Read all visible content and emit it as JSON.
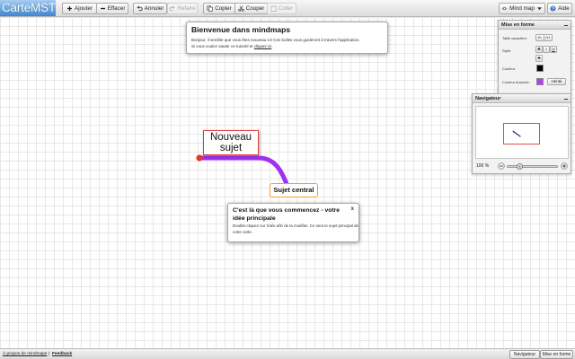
{
  "app": {
    "logo": "CarteMST"
  },
  "toolbar": {
    "add": {
      "label": "Ajouter",
      "icon": "plus-icon"
    },
    "delete": {
      "label": "Effacer",
      "icon": "minus-icon"
    },
    "undo": {
      "label": "Annuler",
      "icon": "undo-icon"
    },
    "redo": {
      "label": "Refaire",
      "icon": "redo-icon",
      "disabled": true
    },
    "copy": {
      "label": "Copier",
      "icon": "copy-icon"
    },
    "cut": {
      "label": "Couper",
      "icon": "scissors-icon"
    },
    "paste": {
      "label": "Coller",
      "icon": "paste-icon",
      "disabled": true
    },
    "mindmap_menu": {
      "label": "Mind map",
      "icon": "mindmap-icon",
      "dropdown_icon": "chevron-down-icon"
    },
    "help": {
      "label": "Aide",
      "icon": "help-icon"
    }
  },
  "welcome_bubble": {
    "title": "Bienvenue dans mindmaps",
    "line1": "Bonjour, il semble que vous êtes nouveau ici! Ces bulles vous guideront à travers l'application.",
    "line2_prefix": "Si vous voulez sauter ce tutoriel et ",
    "skip_link": "cliquez ici",
    "line2_suffix": "."
  },
  "mindmap": {
    "new_node": {
      "text": "Nouveau sujet",
      "selected": true
    },
    "central_node": {
      "text": "Sujet central"
    }
  },
  "tutorial_bubble": {
    "title": "C'est là que vous commencez - votre idée principale",
    "close_label": "x",
    "body": "Double-cliquez sur l'idée afin de la modifier. Ce sera le sujet principal de votre carte."
  },
  "format_panel": {
    "title": "Mise en forme",
    "minimize_icon": "minimize-icon",
    "font_size_label": "Taille caractère:",
    "decrease_label": "A-",
    "increase_label": "A+",
    "style_label": "Style:",
    "bold_label": "B",
    "italic_label": "I",
    "underline_label": "U",
    "strike_label": "S",
    "font_color_label": "Couleur:",
    "branch_color_label": "Couleur branche:",
    "inherit_label": "Hérité"
  },
  "navigator_panel": {
    "title": "Navigateur",
    "minimize_icon": "minimize-icon",
    "zoom_label": "100 %",
    "zoom_slider_level": 0.25,
    "zoom_out_icon": "zoom-out-icon",
    "zoom_in_icon": "zoom-in-icon"
  },
  "footer": {
    "about_link": "À propos de mindmaps",
    "separator": "|",
    "feedback_link": "Feedback",
    "navigator_button": "Navigateur",
    "format_button": "Mise en forme"
  },
  "colors": {
    "logo_bg": "#3f86cf",
    "branch": "#a12ff0",
    "selected_node_border": "#e23b3b",
    "central_node_border": "#f4a21b",
    "font_color_swatch": "#000000",
    "branch_color_swatch": "#b23ff2",
    "viewport_rect": "#e04848",
    "node_dot": "#e2392a",
    "minimap_branch": "#2f2aa0"
  }
}
